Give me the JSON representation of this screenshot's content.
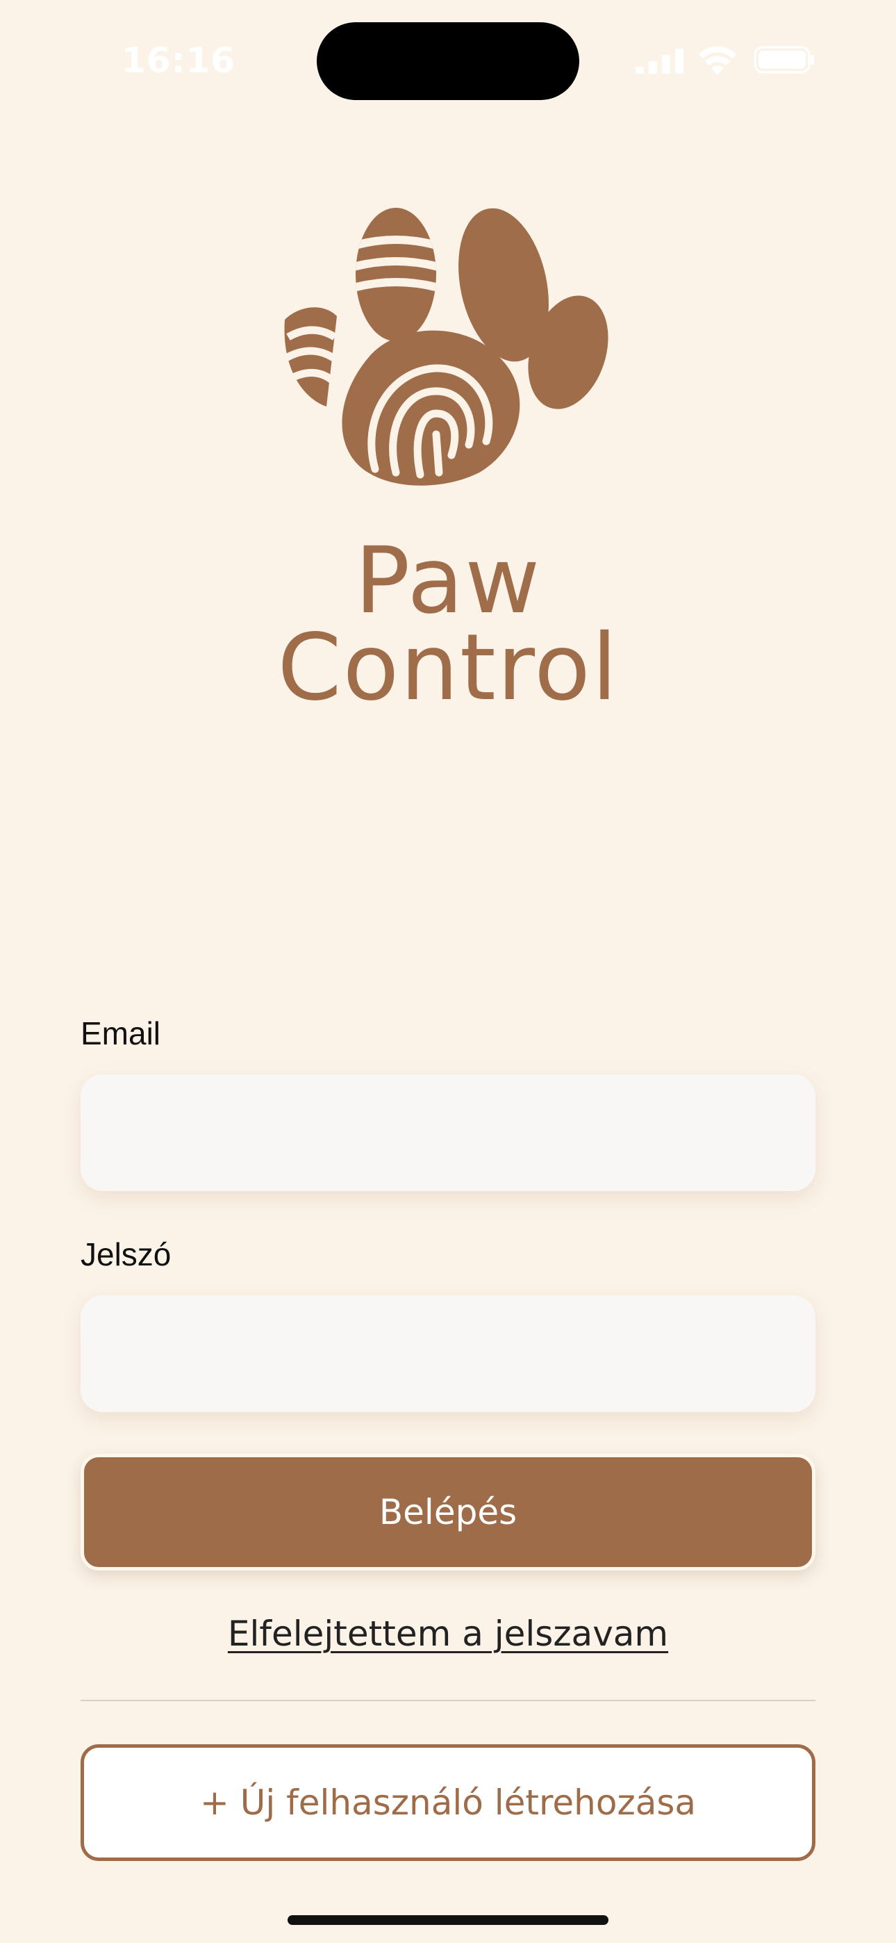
{
  "status_bar": {
    "time": "16:16",
    "icons": [
      "cellular-signal-icon",
      "wifi-icon",
      "battery-icon"
    ]
  },
  "brand": {
    "logo_icon": "paw-fingerprint-logo-icon",
    "name_line1": "Paw",
    "name_line2": "Control",
    "color": "#A06D4A"
  },
  "form": {
    "email_label": "Email",
    "email_value": "",
    "email_placeholder": "",
    "password_label": "Jelszó",
    "password_value": "",
    "password_placeholder": "",
    "login_label": "Belépés",
    "forgot_label": "Elfelejtettem a jelszavam",
    "register_label": "+ Új felhasználó létrehozása"
  },
  "colors": {
    "background": "#FBF3E8",
    "primary": "#9E6C49",
    "input_background": "#F8F7F5"
  }
}
